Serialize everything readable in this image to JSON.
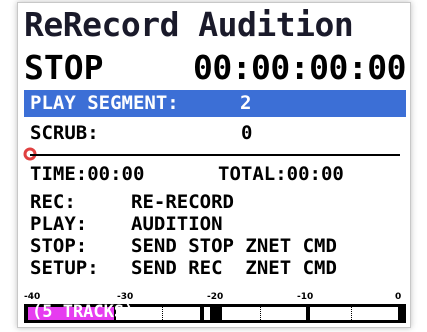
{
  "screen": {
    "title": "ReRecord Audition",
    "transport": {
      "state": "STOP",
      "timecode": "00:00:00:00"
    },
    "segment": {
      "label": "PLAY SEGMENT:",
      "value": "2"
    },
    "scrub": {
      "label": "SCRUB:",
      "value": "0"
    },
    "time": {
      "time_label": "TIME:",
      "time_value": "00:00",
      "total_label": "TOTAL:",
      "total_value": "00:00"
    },
    "keys": [
      {
        "key": "REC:",
        "action": "RE-RECORD"
      },
      {
        "key": "PLAY:",
        "action": "AUDITION"
      },
      {
        "key": "STOP:",
        "action": "SEND STOP ZNET CMD"
      },
      {
        "key": "SETUP:",
        "action": "SEND REC  ZNET CMD"
      }
    ],
    "meter": {
      "scale": [
        "-40",
        "-30",
        "-20",
        "-10",
        "0"
      ],
      "caption": "(5 TRACKS)",
      "level_fraction": 0.23
    }
  },
  "colors": {
    "highlight_bar": "#3c6fd6",
    "meter_fill": "#e63cf0",
    "marker": "#e04040"
  }
}
